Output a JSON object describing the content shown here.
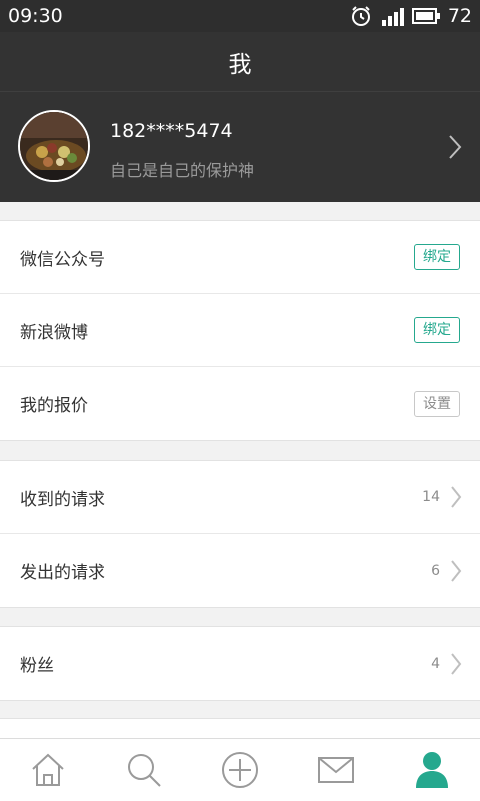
{
  "status_bar": {
    "time": "09:30",
    "battery": "72"
  },
  "header": {
    "title": "我"
  },
  "profile": {
    "phone": "182****5474",
    "motto": "自己是自己的保护神"
  },
  "bindings": [
    {
      "label": "微信公众号",
      "action": "绑定"
    },
    {
      "label": "新浪微博",
      "action": "绑定"
    },
    {
      "label": "我的报价",
      "action": "设置"
    }
  ],
  "requests": [
    {
      "label": "收到的请求",
      "count": "14"
    },
    {
      "label": "发出的请求",
      "count": "6"
    }
  ],
  "social": [
    {
      "label": "粉丝",
      "count": "4"
    }
  ],
  "tabs": [
    "home-icon",
    "search-icon",
    "add-icon",
    "message-icon",
    "profile-icon"
  ],
  "colors": {
    "accent": "#25a88e",
    "header_bg": "#333333"
  }
}
